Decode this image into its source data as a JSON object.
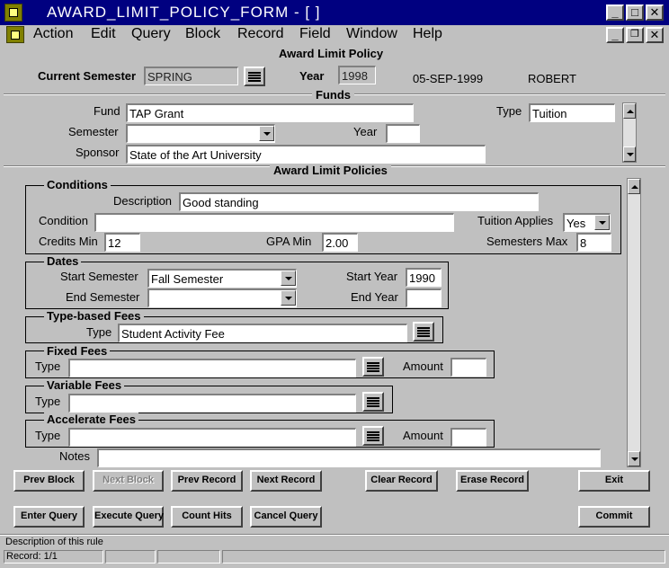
{
  "window": {
    "title": "AWARD_LIMIT_POLICY_FORM - [ ]"
  },
  "menu": [
    "Action",
    "Edit",
    "Query",
    "Block",
    "Record",
    "Field",
    "Window",
    "Help"
  ],
  "form_title": "Award Limit Policy",
  "header": {
    "current_semester_label": "Current Semester",
    "current_semester_value": "SPRING",
    "year_label": "Year",
    "year_value": "1998",
    "date": "05-SEP-1999",
    "user": "ROBERT"
  },
  "funds": {
    "title": "Funds",
    "fund_label": "Fund",
    "fund_value": "TAP Grant",
    "type_label": "Type",
    "type_value": "Tuition",
    "semester_label": "Semester",
    "semester_value": "",
    "year_label": "Year",
    "year_value": "",
    "sponsor_label": "Sponsor",
    "sponsor_value": "State of the Art University"
  },
  "policies": {
    "title": "Award Limit Policies",
    "conditions": {
      "title": "Conditions",
      "description_label": "Description",
      "description_value": "Good standing",
      "condition_label": "Condition",
      "condition_value": "",
      "tuition_applies_label": "Tuition Applies",
      "tuition_applies_value": "Yes",
      "credits_min_label": "Credits Min",
      "credits_min_value": "12",
      "gpa_min_label": "GPA Min",
      "gpa_min_value": "2.00",
      "semesters_max_label": "Semesters Max",
      "semesters_max_value": "8"
    },
    "dates": {
      "title": "Dates",
      "start_semester_label": "Start Semester",
      "start_semester_value": "Fall Semester",
      "start_year_label": "Start Year",
      "start_year_value": "1990",
      "end_semester_label": "End Semester",
      "end_semester_value": "",
      "end_year_label": "End Year",
      "end_year_value": ""
    },
    "type_based_fees": {
      "title": "Type-based Fees",
      "type_label": "Type",
      "type_value": "Student Activity Fee"
    },
    "fixed_fees": {
      "title": "Fixed Fees",
      "type_label": "Type",
      "type_value": "",
      "amount_label": "Amount",
      "amount_value": ""
    },
    "variable_fees": {
      "title": "Variable Fees",
      "type_label": "Type",
      "type_value": ""
    },
    "accelerate_fees": {
      "title": "Accelerate Fees",
      "type_label": "Type",
      "type_value": "",
      "amount_label": "Amount",
      "amount_value": ""
    },
    "notes_label": "Notes",
    "notes_value": ""
  },
  "buttons": {
    "prev_block": "Prev Block",
    "next_block": "Next Block",
    "prev_record": "Prev Record",
    "next_record": "Next Record",
    "clear_record": "Clear Record",
    "erase_record": "Erase Record",
    "exit": "Exit",
    "enter_query": "Enter Query",
    "execute_query": "Execute Query",
    "count_hits": "Count Hits",
    "cancel_query": "Cancel Query",
    "commit": "Commit"
  },
  "status": {
    "message": "Description of this rule",
    "record": "Record: 1/1"
  }
}
